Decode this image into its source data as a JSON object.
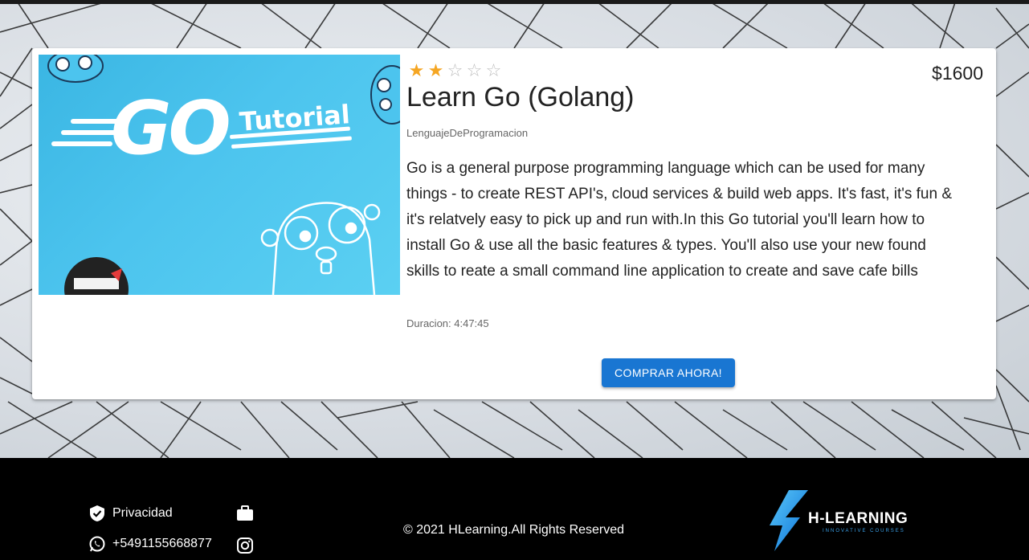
{
  "course": {
    "rating": 2,
    "rating_max": 5,
    "price": "$1600",
    "title": "Learn Go (Golang)",
    "category": "LenguajeDeProgramacion",
    "description": "Go is a general purpose programming language which can be used for many things - to create REST API's, cloud services & build web apps. It's fast, it's fun & it's relatvely easy to pick up and run with.In this Go tutorial you'll learn how to install Go & use all the basic features & types. You'll also use your new found skills to reate a small command line application to create and save cafe bills",
    "duration": "Duracion: 4:47:45",
    "buy_label": "COMPRAR AHORA!",
    "thumbnail": {
      "big_text": "GO",
      "small_text": "Tutorial"
    }
  },
  "footer": {
    "privacy_label": "Privacidad",
    "phone": "+5491155668877",
    "copyright": "© 2021 HLearning.All Rights Reserved",
    "logo_text": "H-LEARNING",
    "logo_subtext": "INNOVATIVE COURSES",
    "icons": [
      "shield-check-icon",
      "briefcase-icon",
      "whatsapp-icon",
      "instagram-icon"
    ]
  },
  "colors": {
    "accent": "#1976d2",
    "star": "#f5a623",
    "footer_bg": "#000000",
    "thumb_bg": "#3ab6e3"
  }
}
